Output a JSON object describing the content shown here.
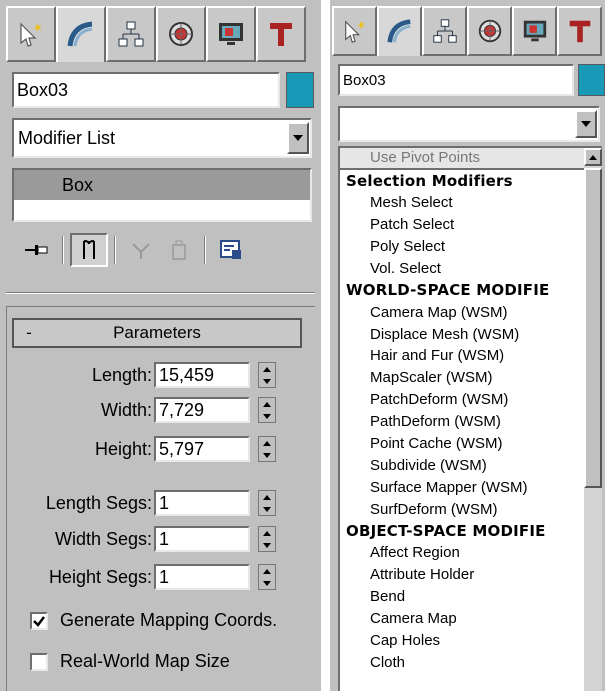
{
  "left": {
    "tabs": [
      "create-tab",
      "modify-tab",
      "hierarchy-tab",
      "motion-tab",
      "display-tab",
      "utilities-tab"
    ],
    "object_name": "Box03",
    "object_color": "#1899b8",
    "modifier_dropdown": "Modifier List",
    "stack_item": "Box",
    "parameters": {
      "title": "Parameters",
      "collapse": "-",
      "fields": [
        {
          "label": "Length:",
          "value": "15,459"
        },
        {
          "label": "Width:",
          "value": "7,729"
        },
        {
          "label": "Height:",
          "value": "5,797"
        },
        {
          "label": "Length Segs:",
          "value": "1"
        },
        {
          "label": "Width Segs:",
          "value": "1"
        },
        {
          "label": "Height Segs:",
          "value": "1"
        }
      ],
      "gen_mapping": {
        "label": "Generate Mapping Coords.",
        "checked": true
      },
      "real_world": {
        "label": "Real-World Map Size",
        "checked": false
      }
    }
  },
  "right": {
    "object_name": "Box03",
    "object_color": "#1899b8",
    "modifier_dropdown": "",
    "list": [
      {
        "text": "Use Pivot Points",
        "kind": "dim"
      },
      {
        "text": "Selection Modifiers",
        "kind": "head"
      },
      {
        "text": "Mesh Select",
        "kind": "item"
      },
      {
        "text": "Patch Select",
        "kind": "item"
      },
      {
        "text": "Poly Select",
        "kind": "item"
      },
      {
        "text": "Vol. Select",
        "kind": "item"
      },
      {
        "text": "WORLD-SPACE MODIFIE",
        "kind": "head"
      },
      {
        "text": "Camera Map (WSM)",
        "kind": "item"
      },
      {
        "text": "Displace Mesh (WSM)",
        "kind": "item"
      },
      {
        "text": "Hair and Fur (WSM)",
        "kind": "item"
      },
      {
        "text": "MapScaler (WSM)",
        "kind": "item"
      },
      {
        "text": "PatchDeform (WSM)",
        "kind": "item"
      },
      {
        "text": "PathDeform (WSM)",
        "kind": "item"
      },
      {
        "text": "Point Cache (WSM)",
        "kind": "item"
      },
      {
        "text": "Subdivide (WSM)",
        "kind": "item"
      },
      {
        "text": "Surface Mapper (WSM)",
        "kind": "item"
      },
      {
        "text": "SurfDeform (WSM)",
        "kind": "item"
      },
      {
        "text": "OBJECT-SPACE MODIFIE",
        "kind": "head"
      },
      {
        "text": "Affect Region",
        "kind": "item"
      },
      {
        "text": "Attribute Holder",
        "kind": "item"
      },
      {
        "text": "Bend",
        "kind": "item"
      },
      {
        "text": "Camera Map",
        "kind": "item"
      },
      {
        "text": "Cap Holes",
        "kind": "item"
      },
      {
        "text": "Cloth",
        "kind": "item"
      }
    ]
  }
}
